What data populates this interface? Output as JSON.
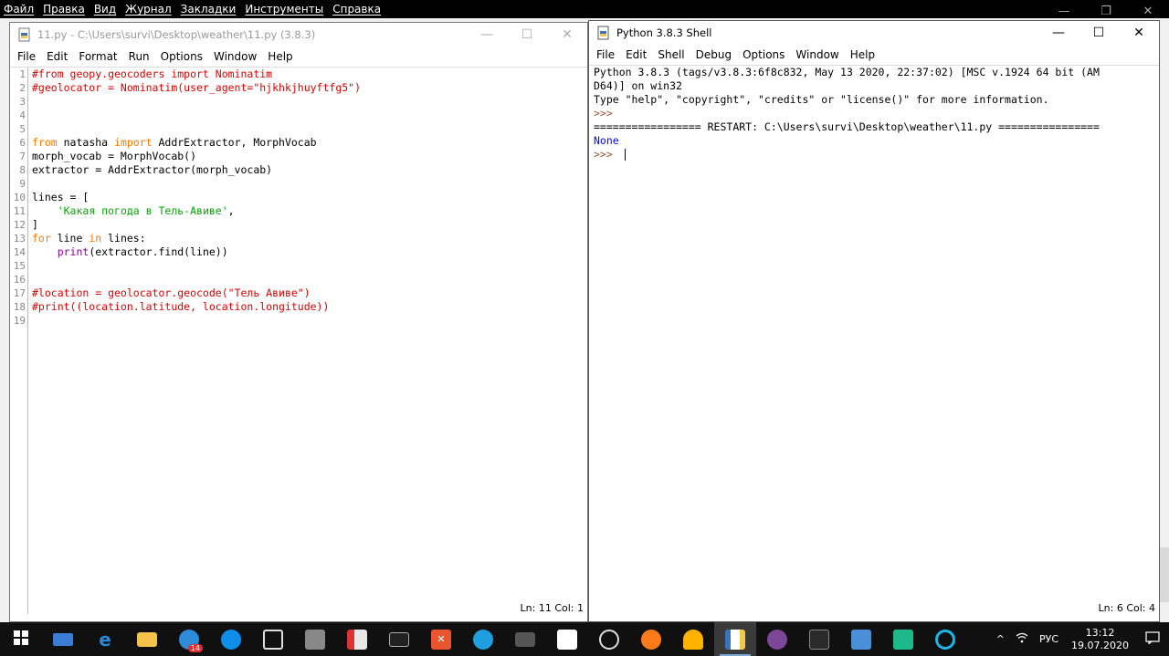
{
  "background_app": {
    "menu": [
      "Файл",
      "Правка",
      "Вид",
      "Журнал",
      "Закладки",
      "Инструменты",
      "Справка"
    ],
    "controls": [
      "—",
      "❐",
      "✕"
    ]
  },
  "editor": {
    "title": "11.py - C:\\Users\\survi\\Desktop\\weather\\11.py (3.8.3)",
    "menu": [
      "File",
      "Edit",
      "Format",
      "Run",
      "Options",
      "Window",
      "Help"
    ],
    "controls": [
      "—",
      "☐",
      "✕"
    ],
    "line_numbers": [
      "1",
      "2",
      "3",
      "4",
      "5",
      "6",
      "7",
      "8",
      "9",
      "10",
      "11",
      "12",
      "13",
      "14",
      "15",
      "16",
      "17",
      "18",
      "19"
    ],
    "status": "Ln: 11   Col: 1",
    "code": {
      "l1": "#from geopy.geocoders import Nominatim",
      "l2": "#geolocator = Nominatim(user_agent=\"hjkhkjhuyftfg5\")",
      "l6_kw1": "from",
      "l6_mod": " natasha ",
      "l6_kw2": "import",
      "l6_rest": " AddrExtractor, MorphVocab",
      "l7": "morph_vocab = MorphVocab()",
      "l8": "extractor = AddrExtractor(morph_vocab)",
      "l10": "lines = [",
      "l11_indent": "    ",
      "l11_str": "'Какая погода в Тель-Авиве'",
      "l11_end": ",",
      "l12": "]",
      "l13_kw1": "for",
      "l13_mid": " line ",
      "l13_kw2": "in",
      "l13_end": " lines:",
      "l14_indent": "    ",
      "l14_bi": "print",
      "l14_end": "(extractor.find(line))",
      "l17": "#location = geolocator.geocode(\"Тель Авиве\")",
      "l18": "#print((location.latitude, location.longitude))"
    }
  },
  "shell": {
    "title": "Python 3.8.3 Shell",
    "menu": [
      "File",
      "Edit",
      "Shell",
      "Debug",
      "Options",
      "Window",
      "Help"
    ],
    "controls": [
      "—",
      "☐",
      "✕"
    ],
    "lines": {
      "banner1": "Python 3.8.3 (tags/v3.8.3:6f8c832, May 13 2020, 22:37:02) [MSC v.1924 64 bit (AM",
      "banner2": "D64)] on win32",
      "banner3": "Type \"help\", \"copyright\", \"credits\" or \"license()\" for more information.",
      "prompt": ">>> ",
      "restart": "================= RESTART: C:\\Users\\survi\\Desktop\\weather\\11.py ================",
      "output": "None"
    },
    "status": "Ln: 6   Col: 4"
  },
  "taskbar": {
    "mail_badge": "14",
    "language": "РУС",
    "time": "13:12",
    "date": "19.07.2020",
    "tray_arrow": "^"
  }
}
